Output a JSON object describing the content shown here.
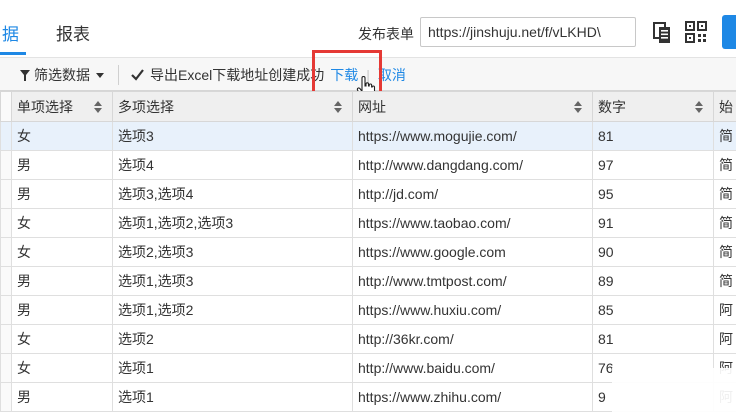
{
  "tabs": {
    "active_label": "据",
    "reports_label": "报表"
  },
  "publish": {
    "label": "发布表单",
    "url": "https://jinshuju.net/f/vLKHD\\"
  },
  "toolbar": {
    "filter_label": "筛选数据",
    "export_message": "导出Excel下载地址创建成功",
    "download_link": "下载",
    "cancel_link": "取消",
    "search_placeholder": ""
  },
  "table": {
    "headers": [
      "单项选择",
      "多项选择",
      "网址",
      "数字",
      "始"
    ],
    "rows": [
      [
        "女",
        "选项3",
        "https://www.mogujie.com/",
        "81",
        "简"
      ],
      [
        "男",
        "选项4",
        "http://www.dangdang.com/",
        "97",
        "简"
      ],
      [
        "男",
        "选项3,选项4",
        "http://jd.com/",
        "95",
        "简"
      ],
      [
        "女",
        "选项1,选项2,选项3",
        "https://www.taobao.com/",
        "91",
        "简"
      ],
      [
        "女",
        "选项2,选项3",
        "https://www.google.com",
        "90",
        "简"
      ],
      [
        "男",
        "选项1,选项3",
        "http://www.tmtpost.com/",
        "89",
        "简"
      ],
      [
        "男",
        "选项1,选项2",
        "https://www.huxiu.com/",
        "85",
        "阿"
      ],
      [
        "女",
        "选项2",
        "http://36kr.com/",
        "81",
        "阿"
      ],
      [
        "女",
        "选项1",
        "http://www.baidu.com/",
        "76",
        "阿"
      ],
      [
        "男",
        "选项1",
        "https://www.zhihu.com/",
        "9",
        "阿"
      ]
    ]
  },
  "colors": {
    "accent": "#1e88e5",
    "highlight": "#e53935",
    "selected_row": "#e8f1fb"
  }
}
